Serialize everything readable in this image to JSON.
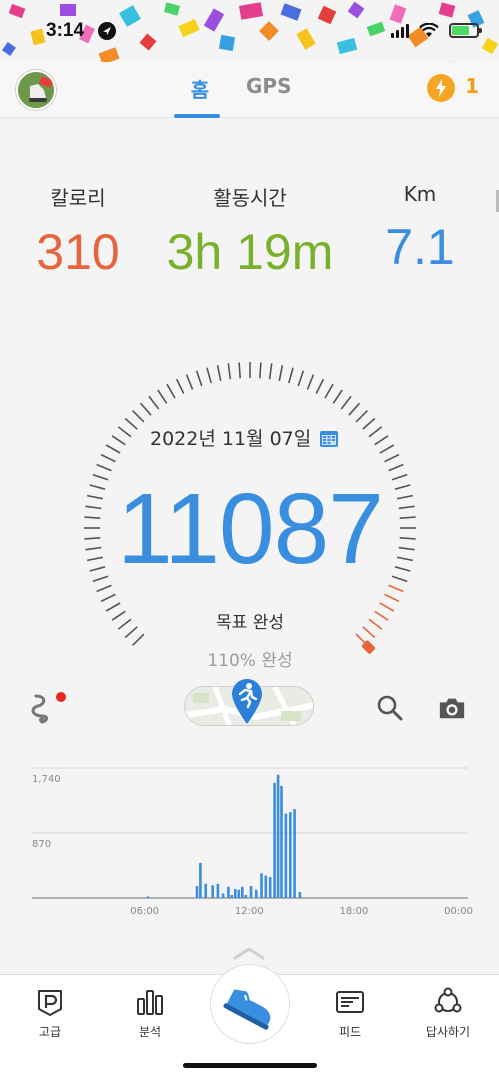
{
  "status_bar": {
    "time": "3:14"
  },
  "header": {
    "tabs": [
      {
        "label": "홈",
        "active": true
      },
      {
        "label": "GPS",
        "active": false
      }
    ],
    "coins": "1"
  },
  "stats": {
    "calories": {
      "label": "칼로리",
      "value": "310"
    },
    "active_time": {
      "label": "활동시간",
      "value": "3h 19m"
    },
    "distance": {
      "label": "Km",
      "value": "7.1"
    }
  },
  "gauge": {
    "date": "2022년 11월 07일",
    "steps": "11087",
    "goal_label": "목표 완성",
    "goal_percent": "110% 완성",
    "progress_fraction": 1.1
  },
  "chart_data": {
    "type": "bar",
    "x_ticks": [
      "06:00",
      "12:00",
      "18:00",
      "00:00"
    ],
    "y_ticks": [
      "1,740",
      "870"
    ],
    "ylim": [
      0,
      1740
    ],
    "xlim_hours": [
      0,
      24
    ],
    "bars": [
      {
        "hour": 6.2,
        "value": 20
      },
      {
        "hour": 9.0,
        "value": 160
      },
      {
        "hour": 9.2,
        "value": 470
      },
      {
        "hour": 9.5,
        "value": 190
      },
      {
        "hour": 9.9,
        "value": 170
      },
      {
        "hour": 10.2,
        "value": 190
      },
      {
        "hour": 10.5,
        "value": 60
      },
      {
        "hour": 10.8,
        "value": 150
      },
      {
        "hour": 11.0,
        "value": 40
      },
      {
        "hour": 11.2,
        "value": 120
      },
      {
        "hour": 11.4,
        "value": 110
      },
      {
        "hour": 11.6,
        "value": 150
      },
      {
        "hour": 11.8,
        "value": 40
      },
      {
        "hour": 12.1,
        "value": 160
      },
      {
        "hour": 12.4,
        "value": 110
      },
      {
        "hour": 12.7,
        "value": 330
      },
      {
        "hour": 12.95,
        "value": 300
      },
      {
        "hour": 13.2,
        "value": 280
      },
      {
        "hour": 13.45,
        "value": 1540
      },
      {
        "hour": 13.65,
        "value": 1650
      },
      {
        "hour": 13.85,
        "value": 1500
      },
      {
        "hour": 14.1,
        "value": 1130
      },
      {
        "hour": 14.35,
        "value": 1150
      },
      {
        "hour": 14.6,
        "value": 1190
      },
      {
        "hour": 14.9,
        "value": 80
      }
    ],
    "bar_color": "#3a8ee0",
    "grid": true
  },
  "bottom_nav": [
    {
      "label": "고급",
      "icon": "premium-p-icon"
    },
    {
      "label": "분석",
      "icon": "bar-chart-icon"
    },
    {
      "label": "",
      "icon": "shoe-icon"
    },
    {
      "label": "피드",
      "icon": "feed-card-icon"
    },
    {
      "label": "답사하기",
      "icon": "explore-people-icon"
    }
  ],
  "colors": {
    "accent": "#3a8ee0",
    "calories": "#e8643c",
    "active_time": "#79b12c",
    "coin": "#f39c12",
    "gauge_end": "#e8643c"
  }
}
